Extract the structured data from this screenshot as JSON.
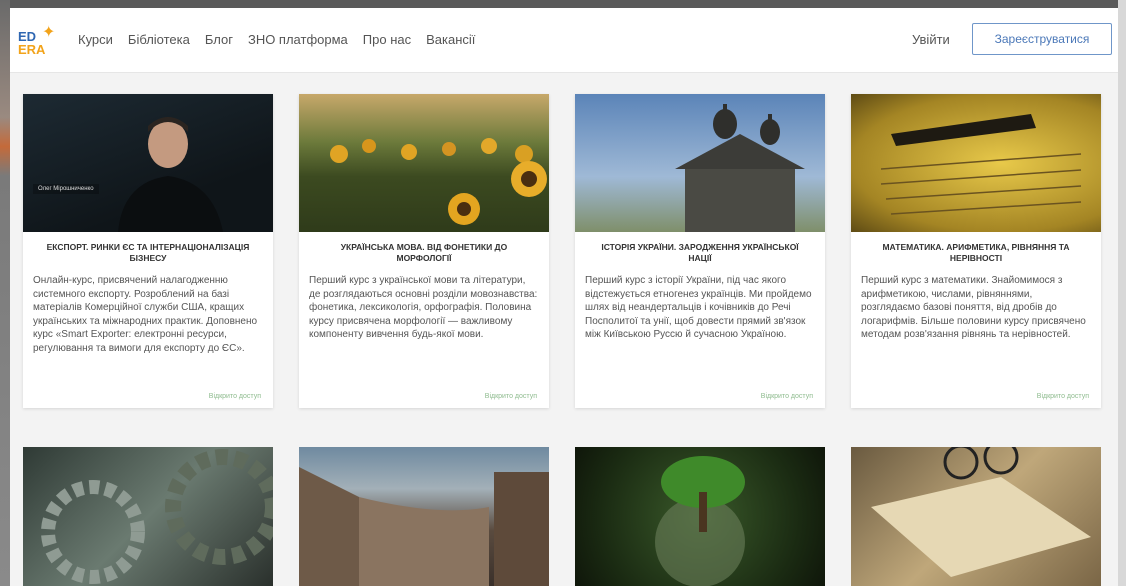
{
  "nav": {
    "logo_top": "ED",
    "logo_bottom": "ERA",
    "links": [
      "Курси",
      "Бібліотека",
      "Блог",
      "ЗНО платформа",
      "Про нас",
      "Вакансії"
    ],
    "login": "Увійти",
    "register": "Зареєструватися"
  },
  "cards": [
    {
      "title": "Експорт. Ринки ЄС та інтернаціоналізація бізнесу",
      "overlay": "Олег Мірошниченко",
      "description": "Онлайн-курс, присвячений налагодженню системного експорту. Розроблений на базі матеріалів Комерційної служби США, кращих українських та міжнародних практик. Доповнено курс «Smart Exporter: електронні ресурси, регулювання та вимоги для експорту до ЄС».",
      "access": "Відкрито доступ"
    },
    {
      "title": "Українська мова. Від фонетики до морфології",
      "description": "Перший курс з української мови та літератури, де розглядаються основні розділи мовознавства: фонетика, лексикологія, орфографія. Половина курсу присвячена морфології — важливому компоненту вивчення будь-якої мови.",
      "access": "Відкрито доступ"
    },
    {
      "title": "Історія України. Зародження української нації",
      "description": "Перший курс з історії України, під час якого відстежується етногенез українців. Ми пройдемо шлях від неандертальців і кочівників до Речі Посполитої та унії, щоб довести прямий зв'язок між Київською Руссю й сучасною Україною.",
      "access": "Відкрито доступ"
    },
    {
      "title": "Математика. Арифметика, рівняння та нерівності",
      "description": "Перший курс з математики. Знайомимося з арифметикою, числами, рівняннями, розглядаємо базові поняття, від дробів до логарифмів. Більше половини курсу присвячено методам розв'язання рівнянь та нерівностей.",
      "access": "Відкрито доступ"
    }
  ]
}
